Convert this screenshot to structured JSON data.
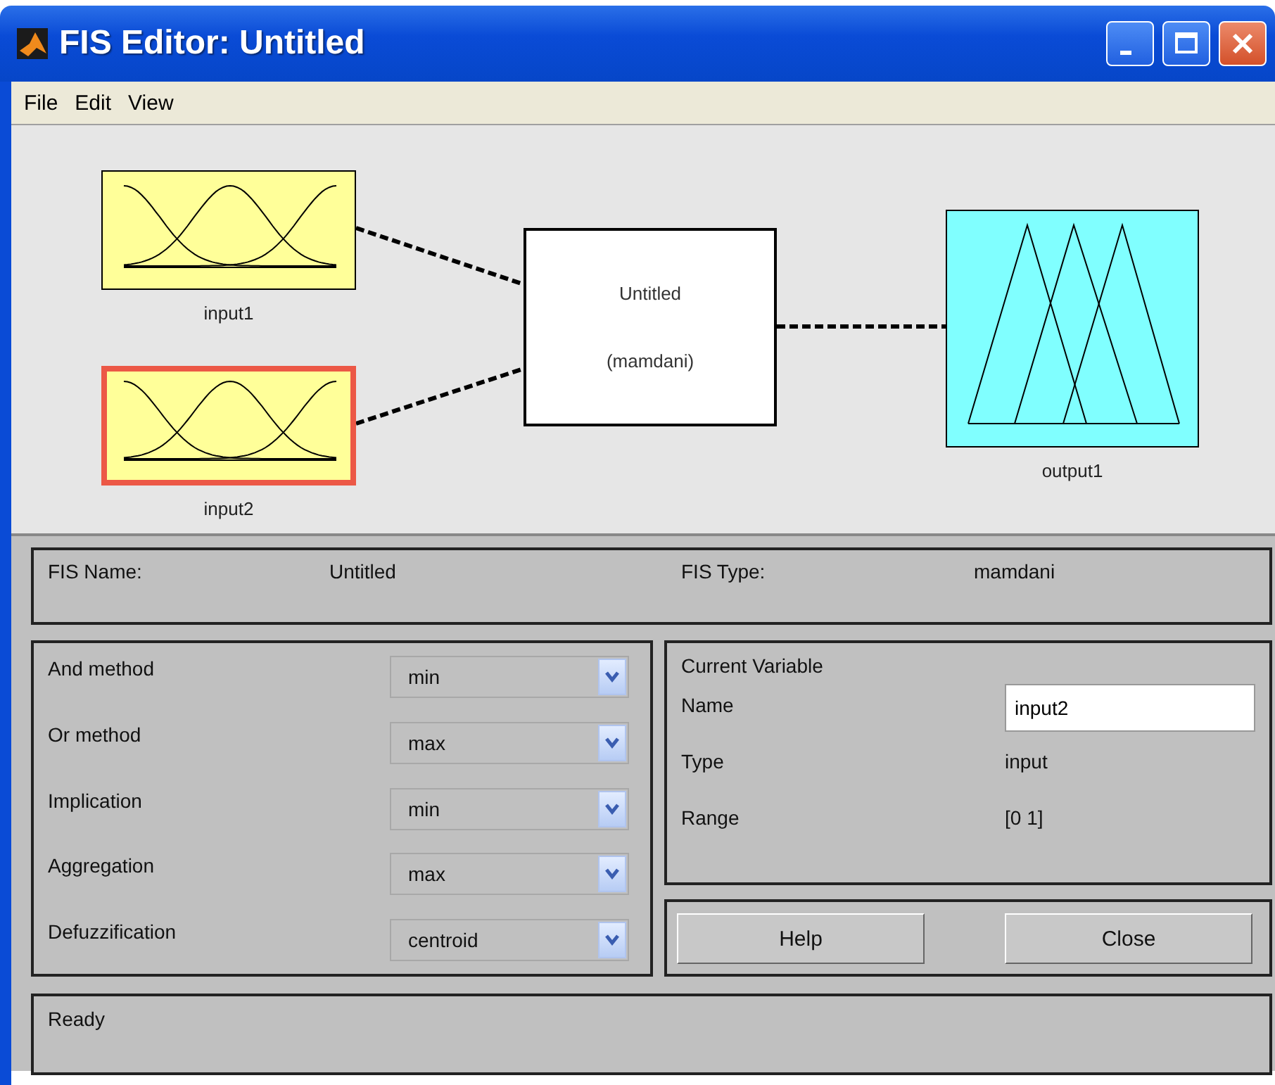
{
  "window": {
    "title": "FIS Editor: Untitled"
  },
  "menu": [
    {
      "label": "File"
    },
    {
      "label": "Edit"
    },
    {
      "label": "View"
    }
  ],
  "diagram": {
    "inputs": [
      {
        "label": "input1",
        "selected": false,
        "kind": "gauss",
        "color": "#ffff99"
      },
      {
        "label": "input2",
        "selected": true,
        "kind": "gauss",
        "color": "#ffff99"
      }
    ],
    "system": {
      "name": "Untitled",
      "type": "(mamdani)"
    },
    "outputs": [
      {
        "label": "output1",
        "selected": false,
        "kind": "triangle",
        "color": "#80ffff"
      }
    ]
  },
  "fis_info": {
    "name_label": "FIS Name:",
    "name": "Untitled",
    "type_label": "FIS Type:",
    "type": "mamdani"
  },
  "methods": [
    {
      "label": "And method",
      "value": "min"
    },
    {
      "label": "Or method",
      "value": "max"
    },
    {
      "label": "Implication",
      "value": "min"
    },
    {
      "label": "Aggregation",
      "value": "max"
    },
    {
      "label": "Defuzzification",
      "value": "centroid"
    }
  ],
  "current_variable": {
    "title": "Current Variable",
    "fields": [
      {
        "label": "Name",
        "value": "input2",
        "kind": "field"
      },
      {
        "label": "Type",
        "value": "input",
        "kind": "text"
      },
      {
        "label": "Range",
        "value": "[0 1]",
        "kind": "text"
      }
    ]
  },
  "buttons": [
    {
      "label": "Help"
    },
    {
      "label": "Close"
    }
  ],
  "status": "Ready"
}
